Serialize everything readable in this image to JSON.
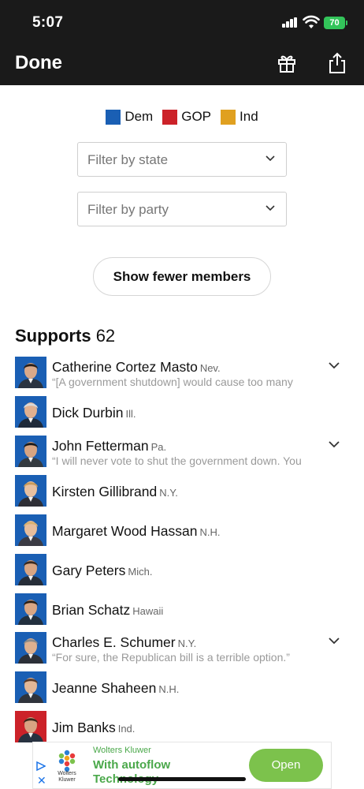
{
  "status_bar": {
    "time": "5:07",
    "battery": "70"
  },
  "top_bar": {
    "done_label": "Done",
    "gift_icon": "gift-icon",
    "share_icon": "share-icon"
  },
  "legend": [
    {
      "label": "Dem",
      "color": "#1a5fb4"
    },
    {
      "label": "GOP",
      "color": "#cc2229"
    },
    {
      "label": "Ind",
      "color": "#e0a020"
    }
  ],
  "filters": {
    "state_placeholder": "Filter by state",
    "party_placeholder": "Filter by party"
  },
  "toggle_label": "Show fewer members",
  "section": {
    "label": "Supports",
    "count": "62"
  },
  "members": [
    {
      "name": "Catherine Cortez Masto",
      "state": "Nev.",
      "quote": "“[A government shutdown] would cause too many",
      "party": "Dem"
    },
    {
      "name": "Dick Durbin",
      "state": "Ill.",
      "quote": "",
      "party": "Dem"
    },
    {
      "name": "John Fetterman",
      "state": "Pa.",
      "quote": "“I will never vote to shut the government down. You",
      "party": "Dem"
    },
    {
      "name": "Kirsten Gillibrand",
      "state": "N.Y.",
      "quote": "",
      "party": "Dem"
    },
    {
      "name": "Margaret Wood Hassan",
      "state": "N.H.",
      "quote": "",
      "party": "Dem"
    },
    {
      "name": "Gary Peters",
      "state": "Mich.",
      "quote": "",
      "party": "Dem"
    },
    {
      "name": "Brian Schatz",
      "state": "Hawaii",
      "quote": "",
      "party": "Dem"
    },
    {
      "name": "Charles E. Schumer",
      "state": "N.Y.",
      "quote": "“For sure, the Republican bill is a terrible option.”",
      "party": "Dem"
    },
    {
      "name": "Jeanne Shaheen",
      "state": "N.H.",
      "quote": "",
      "party": "Dem"
    },
    {
      "name": "Jim Banks",
      "state": "Ind.",
      "quote": "",
      "party": "GOP"
    }
  ],
  "ad": {
    "advertiser": "Wolters Kluwer",
    "headline": "With autoflow Technology",
    "cta": "Open",
    "logo_text": "Wolters Kluwer",
    "close_glyph": "✕",
    "play_icon": "ad-choices-icon"
  }
}
